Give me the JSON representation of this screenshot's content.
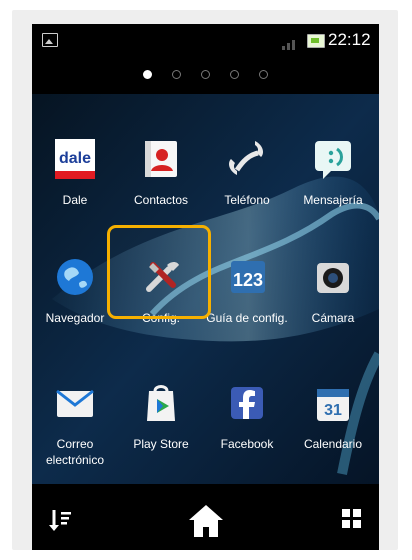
{
  "status_bar": {
    "time": "22:12"
  },
  "home_pages": {
    "dots": 5,
    "active_index": 0
  },
  "apps": [
    {
      "label": "Dale",
      "icon": "dale-icon"
    },
    {
      "label": "Contactos",
      "icon": "contacts-icon"
    },
    {
      "label": "Teléfono",
      "icon": "phone-icon"
    },
    {
      "label": "Mensajería",
      "icon": "message-icon"
    },
    {
      "label": "Navegador",
      "icon": "globe-icon"
    },
    {
      "label": "Config.",
      "icon": "settings-tools-icon"
    },
    {
      "label": "Guía de config.",
      "icon": "setup-guide-icon"
    },
    {
      "label": "Cámara",
      "icon": "camera-icon"
    },
    {
      "label": "Correo electrónico",
      "icon": "mail-icon"
    },
    {
      "label": "Play Store",
      "icon": "play-store-icon"
    },
    {
      "label": "Facebook",
      "icon": "facebook-icon"
    },
    {
      "label": "Calendario",
      "icon": "calendar-icon"
    }
  ],
  "calendar_icon_day": "31",
  "setup_guide_icon_text": "123",
  "dale_icon_text": "dale",
  "colors": {
    "highlight": "#f6b000",
    "background": "#0b1f33",
    "accent": "#1e78d6"
  }
}
